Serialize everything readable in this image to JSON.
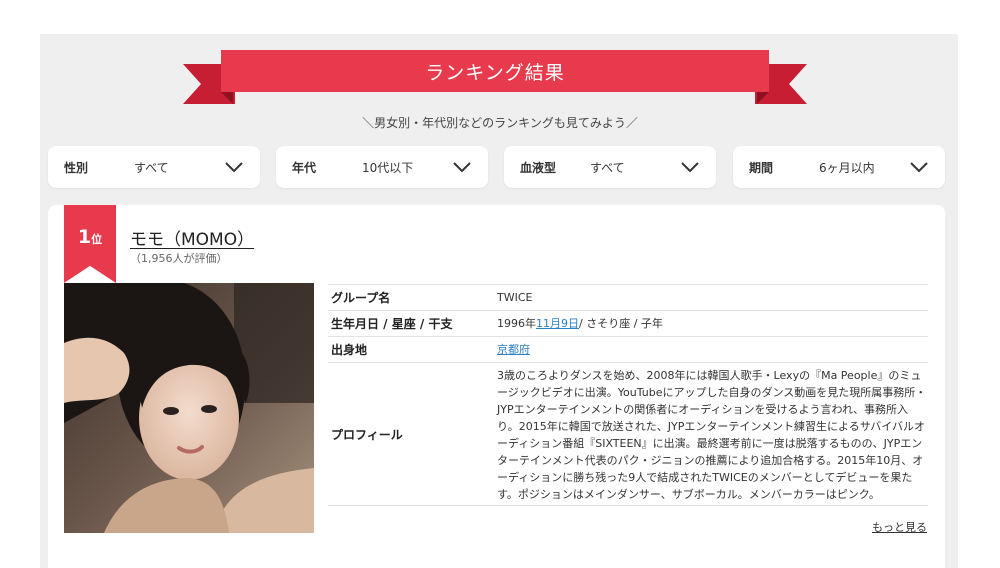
{
  "header": {
    "title": "ランキング結果",
    "subtitle": "＼男女別・年代別などのランキングも見てみよう／"
  },
  "filters": [
    {
      "label": "性別",
      "value": "すべて"
    },
    {
      "label": "年代",
      "value": "10代以下"
    },
    {
      "label": "血液型",
      "value": "すべて"
    },
    {
      "label": "期間",
      "value": "6ヶ月以内"
    }
  ],
  "colors": {
    "accent": "#e73b4d",
    "accent_dark": "#c81e34",
    "link": "#2a7fc9"
  },
  "result": {
    "rank_number": "1",
    "rank_unit": "位",
    "name": "モモ（MOMO）",
    "rating_count": "（1,956人が評価）",
    "photo_icon": "portrait-photo",
    "info": {
      "group_label": "グループ名",
      "group_value": "TWICE",
      "birth_label": "生年月日 / 星座 / 干支",
      "birth_year": "1996年",
      "birth_date_link": "11月9日",
      "birth_rest": " / さそり座 / 子年",
      "birthplace_label": "出身地",
      "birthplace_value": "京都府",
      "profile_label": "プロフィール",
      "profile_text": "3歳のころよりダンスを始め、2008年には韓国人歌手・Lexyの『Ma People』のミュージックビデオに出演。YouTubeにアップした自身のダンス動画を見た現所属事務所・JYPエンターテインメントの関係者にオーディションを受けるよう言われ、事務所入り。2015年に韓国で放送された、JYPエンターテインメント練習生によるサバイバルオーディション番組『SIXTEEN』に出演。最終選考前に一度は脱落するものの、JYPエンターテインメント代表のパク・ジニョンの推薦により追加合格する。2015年10月、オーディションに勝ち残った9人で結成されたTWICEのメンバーとしてデビューを果たす。ポジションはメインダンサー、サブボーカル。メンバーカラーはピンク。"
    },
    "more_label": "もっと見る"
  }
}
